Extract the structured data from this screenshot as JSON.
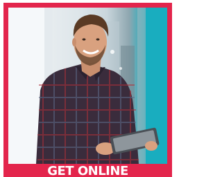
{
  "cta": {
    "label": "GET ONLINE"
  },
  "colors": {
    "frame": "#e3254c",
    "accent_teal": "#18a9bb",
    "background": "#ffffff"
  },
  "photo": {
    "subject": "man-holding-tablet"
  }
}
